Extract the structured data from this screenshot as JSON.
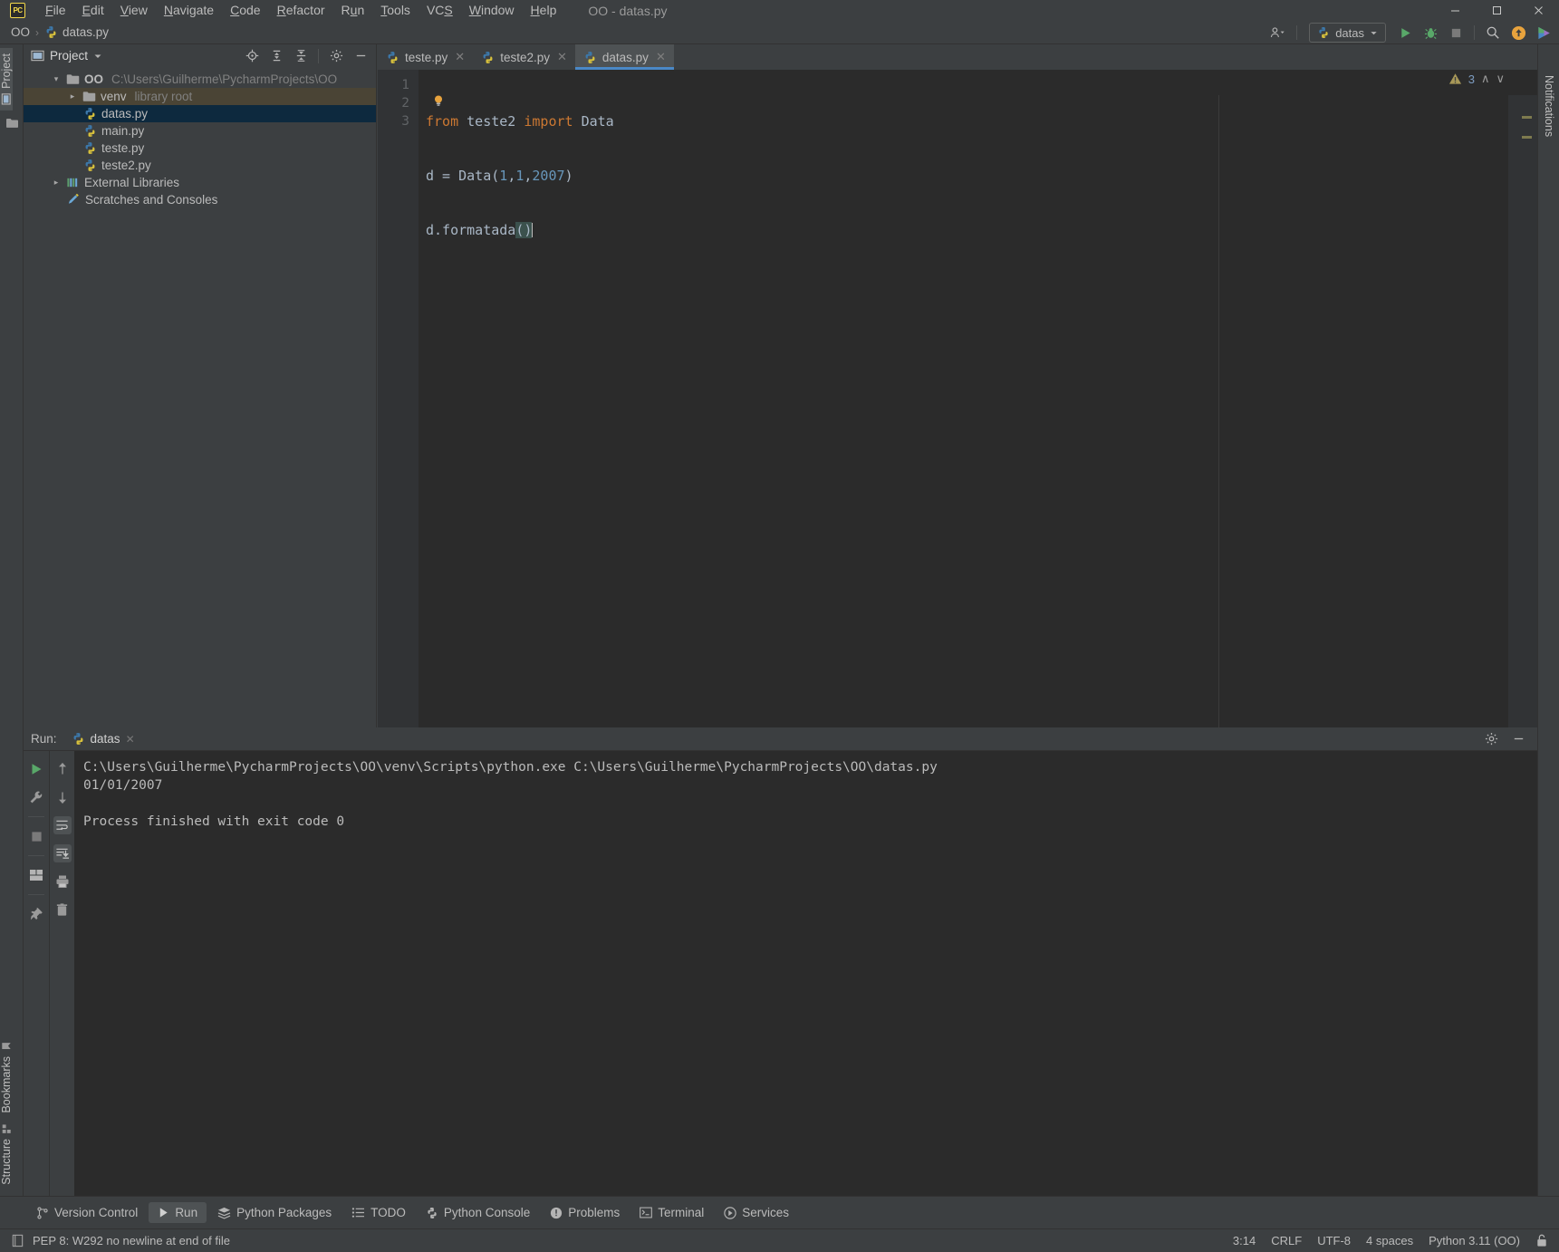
{
  "window": {
    "app_badge": "PC",
    "title": "OO - datas.py",
    "minimize": "—",
    "maximize": "☐",
    "close": "✕"
  },
  "menubar": {
    "items": [
      {
        "label": "File",
        "mnemonic": "F"
      },
      {
        "label": "Edit",
        "mnemonic": "E"
      },
      {
        "label": "View",
        "mnemonic": "V"
      },
      {
        "label": "Navigate",
        "mnemonic": "N"
      },
      {
        "label": "Code",
        "mnemonic": "C"
      },
      {
        "label": "Refactor",
        "mnemonic": "R"
      },
      {
        "label": "Run",
        "mnemonic": "u"
      },
      {
        "label": "Tools",
        "mnemonic": "T"
      },
      {
        "label": "VCS",
        "mnemonic": "S"
      },
      {
        "label": "Window",
        "mnemonic": "W"
      },
      {
        "label": "Help",
        "mnemonic": "H"
      }
    ]
  },
  "navbar": {
    "crumbs": [
      "OO",
      "datas.py"
    ],
    "separator": "›",
    "run_config": "datas",
    "icons": {
      "account": "account-icon",
      "dropdown": "chevron-down-icon",
      "run": "run-icon",
      "debug": "debug-icon",
      "stop": "stop-icon",
      "search": "search-icon",
      "update": "update-badge-icon",
      "ai": "ai-assistant-icon"
    }
  },
  "left_rail": {
    "top": [
      {
        "label": "Project",
        "active": true
      }
    ],
    "bottom": [
      {
        "label": "Bookmarks",
        "active": false
      },
      {
        "label": "Structure",
        "active": false
      }
    ]
  },
  "right_rail": {
    "labels": [
      "Notifications"
    ]
  },
  "project_panel": {
    "title": "Project",
    "tools": [
      "locate-icon",
      "expand-all-icon",
      "collapse-all-icon",
      "gear-icon",
      "minimize-icon"
    ],
    "tree": [
      {
        "label": "OO",
        "sub": "C:\\Users\\Guilherme\\PycharmProjects\\OO",
        "indent": 0,
        "arrow": "expanded",
        "icon": "folder",
        "state": "none"
      },
      {
        "label": "venv",
        "sub": "library root",
        "indent": 1,
        "arrow": "collapsed",
        "icon": "folder",
        "state": "hovered"
      },
      {
        "label": "datas.py",
        "sub": "",
        "indent": 2,
        "arrow": "none",
        "icon": "python",
        "state": "selected"
      },
      {
        "label": "main.py",
        "sub": "",
        "indent": 2,
        "arrow": "none",
        "icon": "python",
        "state": "none"
      },
      {
        "label": "teste.py",
        "sub": "",
        "indent": 2,
        "arrow": "none",
        "icon": "python",
        "state": "none"
      },
      {
        "label": "teste2.py",
        "sub": "",
        "indent": 2,
        "arrow": "none",
        "icon": "python",
        "state": "none"
      },
      {
        "label": "External Libraries",
        "sub": "",
        "indent": 0,
        "arrow": "collapsed",
        "icon": "library",
        "state": "none"
      },
      {
        "label": "Scratches and Consoles",
        "sub": "",
        "indent": 0,
        "arrow": "none",
        "icon": "scratch",
        "state": "none"
      }
    ]
  },
  "editor": {
    "tabs": [
      {
        "label": "teste.py",
        "active": false
      },
      {
        "label": "teste2.py",
        "active": false
      },
      {
        "label": "datas.py",
        "active": true
      }
    ],
    "close_glyph": "✕",
    "line_numbers": [
      "1",
      "2",
      "3"
    ],
    "code_lines": [
      {
        "n": 1,
        "tokens": [
          {
            "t": "from",
            "c": "kw"
          },
          {
            "t": " ",
            "c": "plain"
          },
          {
            "t": "teste2",
            "c": "plain"
          },
          {
            "t": " ",
            "c": "plain"
          },
          {
            "t": "import",
            "c": "kw"
          },
          {
            "t": " ",
            "c": "plain"
          },
          {
            "t": "Data",
            "c": "cls"
          }
        ]
      },
      {
        "n": 2,
        "tokens": [
          {
            "t": "d",
            "c": "plain"
          },
          {
            "t": " = ",
            "c": "plain"
          },
          {
            "t": "Data",
            "c": "plain"
          },
          {
            "t": "(",
            "c": "plain"
          },
          {
            "t": "1",
            "c": "num"
          },
          {
            "t": ",",
            "c": "plain"
          },
          {
            "t": "1",
            "c": "num"
          },
          {
            "t": ",",
            "c": "plain"
          },
          {
            "t": "2007",
            "c": "num"
          },
          {
            "t": ")",
            "c": "plain"
          }
        ]
      },
      {
        "n": 3,
        "tokens": [
          {
            "t": "d.formatada",
            "c": "plain"
          },
          {
            "t": "()",
            "c": "paren"
          }
        ]
      }
    ],
    "inspection": {
      "icon": "warning-triangle-icon",
      "count": "3",
      "prev": "∧",
      "next": "∨"
    },
    "lightbulb": "intention-bulb-icon"
  },
  "run_window": {
    "label": "Run:",
    "tab": "datas",
    "tab_close": "✕",
    "header_icons": [
      "gear-icon",
      "minimize-icon"
    ],
    "tool_col_1": [
      "rerun-icon",
      "wrench-icon",
      "stop-icon",
      "layout-icon",
      "pin-icon"
    ],
    "tool_col_2": [
      "arrow-up-icon",
      "arrow-down-icon",
      "soft-wrap-icon",
      "scroll-to-end-icon",
      "print-icon",
      "trash-icon"
    ],
    "console_lines": [
      "C:\\Users\\Guilherme\\PycharmProjects\\OO\\venv\\Scripts\\python.exe C:\\Users\\Guilherme\\PycharmProjects\\OO\\datas.py",
      "01/01/2007",
      "",
      "Process finished with exit code 0"
    ]
  },
  "bottom_bar": {
    "items": [
      {
        "label": "Version Control",
        "icon": "branch-icon",
        "active": false
      },
      {
        "label": "Run",
        "icon": "run-icon",
        "active": true
      },
      {
        "label": "Python Packages",
        "icon": "packages-icon",
        "active": false
      },
      {
        "label": "TODO",
        "icon": "todo-icon",
        "active": false
      },
      {
        "label": "Python Console",
        "icon": "python-icon",
        "active": false
      },
      {
        "label": "Problems",
        "icon": "problems-icon",
        "active": false
      },
      {
        "label": "Terminal",
        "icon": "terminal-icon",
        "active": false
      },
      {
        "label": "Services",
        "icon": "services-icon",
        "active": false
      }
    ]
  },
  "status_bar": {
    "message": "PEP 8: W292 no newline at end of file",
    "message_icon": "inspection-icon",
    "caret": "3:14",
    "line_separator": "CRLF",
    "encoding": "UTF-8",
    "indent": "4 spaces",
    "interpreter": "Python 3.11 (OO)",
    "lock_icon": "lock-icon"
  },
  "colors": {
    "bg_panel": "#3c3f41",
    "bg_editor": "#2b2b2b",
    "accent_blue": "#4a88c7",
    "selection": "#0d293e",
    "keyword_orange": "#cc7832",
    "number_blue": "#6897bb",
    "text": "#a9b7c6"
  }
}
